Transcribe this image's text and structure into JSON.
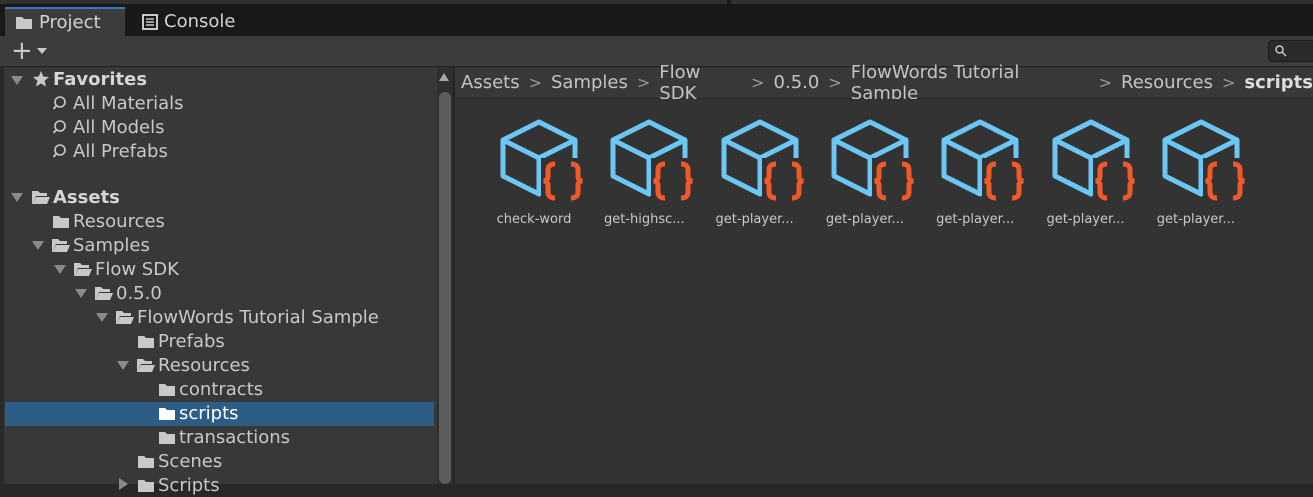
{
  "tabs": [
    {
      "label": "Project",
      "icon": "folder-icon"
    },
    {
      "label": "Console",
      "icon": "console-icon"
    }
  ],
  "toolbar": {
    "add_label": "+",
    "search_icon": "search-icon"
  },
  "favorites": {
    "label": "Favorites",
    "items": [
      "All Materials",
      "All Models",
      "All Prefabs"
    ]
  },
  "tree": {
    "assets": "Assets",
    "resources": "Resources",
    "samples": "Samples",
    "flow_sdk": "Flow SDK",
    "version": "0.5.0",
    "flowwords": "FlowWords Tutorial Sample",
    "prefabs": "Prefabs",
    "res2": "Resources",
    "contracts": "contracts",
    "scripts": "scripts",
    "transactions": "transactions",
    "scenes": "Scenes",
    "scripts2": "Scripts"
  },
  "breadcrumb": [
    "Assets",
    "Samples",
    "Flow SDK",
    "0.5.0",
    "FlowWords Tutorial Sample",
    "Resources",
    "scripts"
  ],
  "assets": [
    "check-word",
    "get-highsc...",
    "get-player...",
    "get-player...",
    "get-player...",
    "get-player...",
    "get-player..."
  ],
  "colors": {
    "selection": "#2c5d87",
    "tab_accent": "#3a79bb",
    "cube": "#6cc7f5",
    "braces": "#f05a28"
  }
}
